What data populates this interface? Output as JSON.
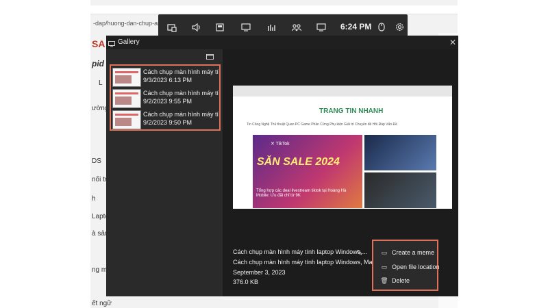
{
  "background": {
    "url": "-dap/huong-dan-chup-anh",
    "fragments": [
      "SA",
      "pid",
      "L",
      "ường",
      "DS",
      "nối tra",
      "h",
      "Lapto",
      "à sản",
      "ng mi",
      "ết ngữ"
    ]
  },
  "gamebar": {
    "time": "6:24 PM",
    "icons": [
      "widget-menu-icon",
      "audio-icon",
      "capture-icon",
      "performance-icon",
      "resources-icon",
      "social-icon",
      "gallery-icon",
      "mouse-icon",
      "settings-icon"
    ]
  },
  "gallery": {
    "title": "Gallery",
    "captures": [
      {
        "name": "Cách chụp màn hình máy tín...",
        "date": "9/3/2023 6:13 PM"
      },
      {
        "name": "Cách chụp màn hình máy tín...",
        "date": "9/2/2023 9:55 PM"
      },
      {
        "name": "Cách chụp màn hình máy tín...",
        "date": "9/2/2023 9:50 PM"
      }
    ],
    "preview": {
      "site_logo": "TRANG TIN NHANH",
      "nav": "Tin Công Nghệ   Thủ thuật   Quan PC   Game   Phần Cứng   Phụ kiện   Giải trí   Chuyên đề   Hỏi Đáp Vấn Đề",
      "hero_title": "SĂN SALE 2024",
      "hero_text": "Tổng hợp các deal livestream tiktok tại Hoàng Hà Mobile: Ưu đãi chỉ từ 9K",
      "tiktok": "✕ TikTok"
    },
    "details": {
      "title_short": "Cách chụp màn hình máy tính laptop Windows,...",
      "title_full": "Cách chụp màn hình máy tính laptop Windows, MacBo...",
      "date": "September 3, 2023",
      "size": "376.0 KB"
    },
    "menu": [
      {
        "label": "Create a meme",
        "icon": "meme-icon"
      },
      {
        "label": "Open file location",
        "icon": "folder-icon"
      },
      {
        "label": "Delete",
        "icon": "trash-icon"
      }
    ],
    "accent_color": "#e07058"
  }
}
